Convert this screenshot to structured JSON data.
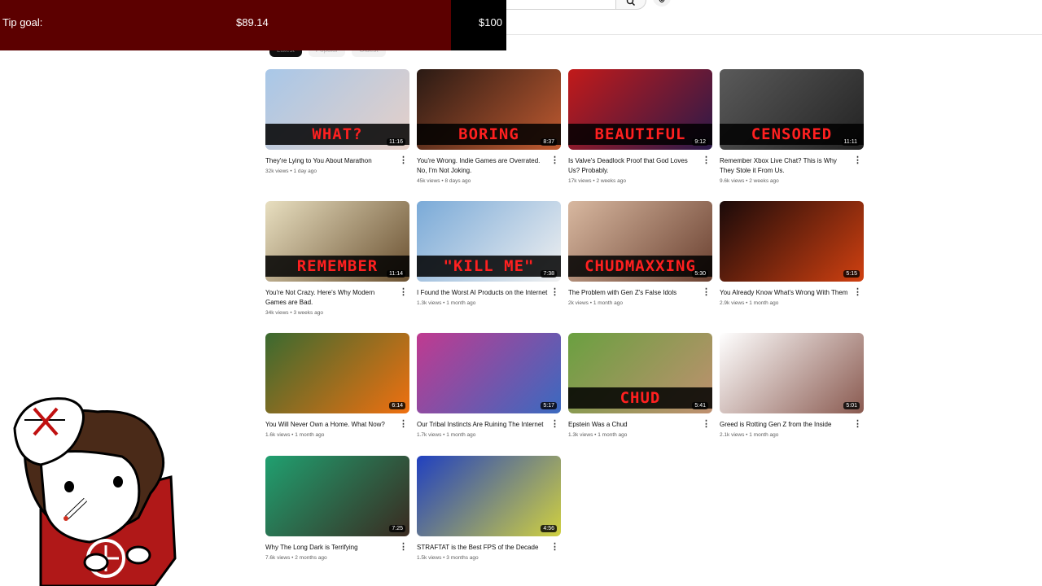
{
  "tip_goal": {
    "label": "Tip goal:",
    "current": "$89.14",
    "target": "$100",
    "progress": 0.89
  },
  "chips": [
    "Latest",
    "Popular",
    "Oldest"
  ],
  "videos": [
    {
      "title": "They're Lying to You About Marathon",
      "views": "32k views",
      "age": "1 day ago",
      "duration": "11:16",
      "thumb_text": "WHAT?",
      "colors": [
        "#a8c7e8",
        "#e6d0c8"
      ]
    },
    {
      "title": "You're Wrong. Indie Games are Overrated. No, I'm Not Joking.",
      "views": "45k views",
      "age": "8 days ago",
      "duration": "8:37",
      "thumb_text": "BORING",
      "colors": [
        "#2a1a14",
        "#c05a30"
      ]
    },
    {
      "title": "Is Valve's Deadlock Proof that God Loves Us? Probably.",
      "views": "17k views",
      "age": "2 weeks ago",
      "duration": "9:12",
      "thumb_text": "BEAUTIFUL",
      "colors": [
        "#c21a1a",
        "#2a1a4a"
      ]
    },
    {
      "title": "Remember Xbox Live Chat? This is Why They Stole it From Us.",
      "views": "9.6k views",
      "age": "2 weeks ago",
      "duration": "11:11",
      "thumb_text": "CENSORED",
      "colors": [
        "#5a5a5a",
        "#222222"
      ]
    },
    {
      "title": "You're Not Crazy. Here's Why Modern Games are Bad.",
      "views": "34k views",
      "age": "3 weeks ago",
      "duration": "11:14",
      "thumb_text": "REMEMBER",
      "colors": [
        "#e8dfc0",
        "#6a5030"
      ]
    },
    {
      "title": "I Found the Worst AI Products on the Internet",
      "views": "1.3k views",
      "age": "1 month ago",
      "duration": "7:38",
      "thumb_text": "\"KILL ME\"",
      "colors": [
        "#7aaad8",
        "#f0f0f0"
      ]
    },
    {
      "title": "The Problem with Gen Z's False Idols",
      "views": "2k views",
      "age": "1 month ago",
      "duration": "5:30",
      "thumb_text": "CHUDMAXXING",
      "colors": [
        "#d8b8a0",
        "#6a4030"
      ]
    },
    {
      "title": "You Already Know What's Wrong With Them",
      "views": "2.9k views",
      "age": "1 month ago",
      "duration": "5:15",
      "thumb_text": "",
      "colors": [
        "#1a0a0a",
        "#d04010"
      ]
    },
    {
      "title": "You Will Never Own a Home. What Now?",
      "views": "1.6k views",
      "age": "1 month ago",
      "duration": "6:14",
      "thumb_text": "",
      "colors": [
        "#3a6a30",
        "#f07010"
      ]
    },
    {
      "title": "Our Tribal Instincts Are Ruining The Internet",
      "views": "1.7k views",
      "age": "1 month ago",
      "duration": "5:17",
      "thumb_text": "",
      "colors": [
        "#c03a90",
        "#3a6ac0"
      ]
    },
    {
      "title": "Epstein Was a Chud",
      "views": "1.3k views",
      "age": "1 month ago",
      "duration": "5:41",
      "thumb_text": "CHUD",
      "colors": [
        "#6aa040",
        "#c09070"
      ]
    },
    {
      "title": "Greed is Rotting Gen Z from the Inside",
      "views": "2.1k views",
      "age": "1 month ago",
      "duration": "5:01",
      "thumb_text": "",
      "colors": [
        "#ffffff",
        "#8a5a50"
      ]
    },
    {
      "title": "Why The Long Dark is Terrifying",
      "views": "7.6k views",
      "age": "2 months ago",
      "duration": "7:25",
      "thumb_text": "",
      "colors": [
        "#20a070",
        "#3a2a20"
      ]
    },
    {
      "title": "STRAFTAT is the Best FPS of the Decade",
      "views": "1.5k views",
      "age": "3 months ago",
      "duration": "4:56",
      "thumb_text": "",
      "colors": [
        "#2040c0",
        "#d0d040"
      ]
    }
  ]
}
